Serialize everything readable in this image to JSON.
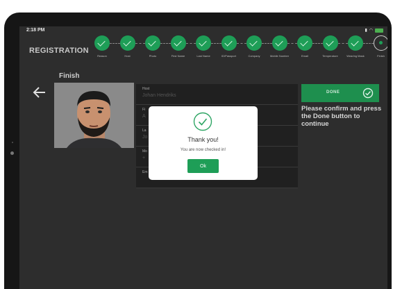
{
  "status_bar": {
    "time": "2:18 PM",
    "signal": "▮▮▮",
    "wifi": "wifi",
    "battery_label": ""
  },
  "header": {
    "title": "REGISTRATION"
  },
  "steps": [
    {
      "label": "Reason",
      "state": "done"
    },
    {
      "label": "Host",
      "state": "done"
    },
    {
      "label": "Photo",
      "state": "done"
    },
    {
      "label": "First Name",
      "state": "done"
    },
    {
      "label": "Last Name",
      "state": "done"
    },
    {
      "label": "ID/Passport",
      "state": "done"
    },
    {
      "label": "Company",
      "state": "done"
    },
    {
      "label": "Mobile Number",
      "state": "done"
    },
    {
      "label": "Email",
      "state": "done"
    },
    {
      "label": "Temperature",
      "state": "done"
    },
    {
      "label": "Wearing Mask",
      "state": "done"
    },
    {
      "label": "Finish",
      "state": "current"
    }
  ],
  "page": {
    "title": "Finish"
  },
  "form": {
    "fields": [
      {
        "label": "Host",
        "value": "Johan Hendriks"
      },
      {
        "label": "Fi",
        "value": "A"
      },
      {
        "label": "La",
        "value": "Jo"
      },
      {
        "label": "Mo",
        "value": "+"
      },
      {
        "label": "Em",
        "value": ""
      }
    ]
  },
  "done_button": {
    "label": "DONE"
  },
  "instructions": "Please confirm and press the Done button to continue",
  "modal": {
    "title": "Thank you!",
    "message": "You are now checked in!",
    "ok_label": "Ok"
  },
  "colors": {
    "accent": "#1e9e57",
    "background": "#2d2d2d",
    "panel": "#202020"
  },
  "icons": {
    "back": "arrow-left-icon",
    "check": "check-circle-icon",
    "step_done": "check-icon"
  }
}
